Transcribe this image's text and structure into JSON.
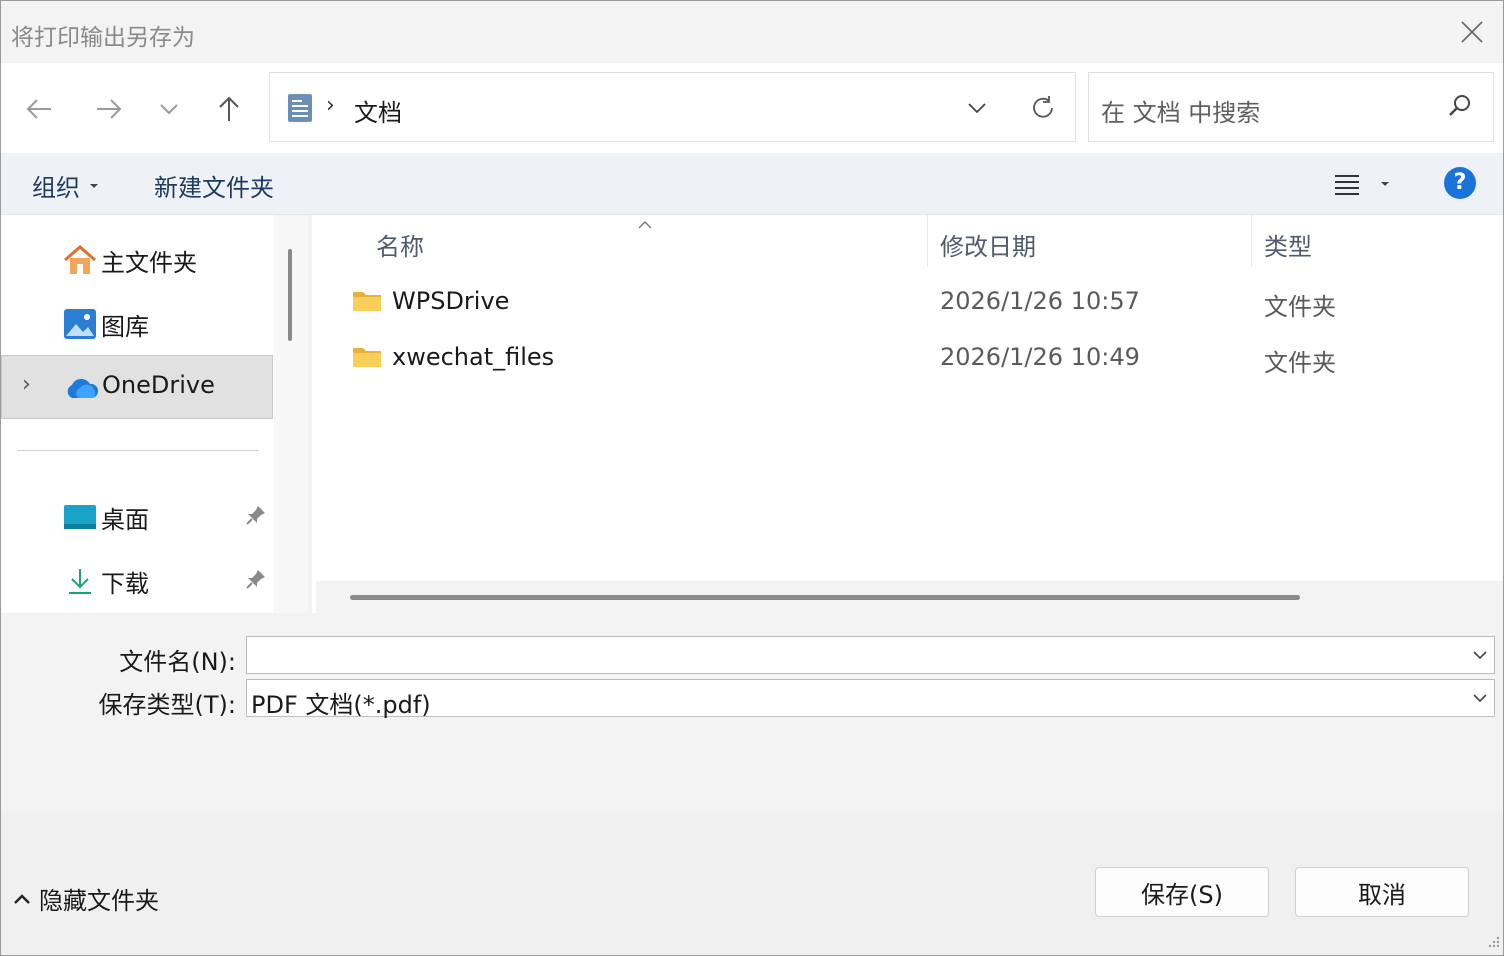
{
  "window": {
    "title": "将打印输出另存为"
  },
  "nav": {
    "back_icon": "arrow-left-icon",
    "forward_icon": "arrow-right-icon",
    "recent_icon": "chevron-down-icon",
    "up_icon": "arrow-up-icon"
  },
  "address": {
    "separator": "›",
    "location": "文档"
  },
  "search": {
    "placeholder": "在 文档 中搜索"
  },
  "commandbar": {
    "organize_label": "组织",
    "newfolder_label": "新建文件夹",
    "help_label": "?"
  },
  "navpane": {
    "items": [
      {
        "label": "主文件夹",
        "icon": "home-icon"
      },
      {
        "label": "图库",
        "icon": "gallery-icon"
      },
      {
        "label": "OneDrive",
        "icon": "onedrive-cloud-icon",
        "selected": true,
        "expander": "›"
      },
      {
        "label": "桌面",
        "icon": "desktop-icon",
        "pinned": true
      },
      {
        "label": "下载",
        "icon": "download-icon",
        "pinned": true
      }
    ]
  },
  "filelist": {
    "columns": [
      "名称",
      "修改日期",
      "类型"
    ],
    "rows": [
      {
        "name": "WPSDrive",
        "date": "2026/1/26 10:57",
        "type": "文件夹"
      },
      {
        "name": "xwechat_files",
        "date": "2026/1/26 10:49",
        "type": "文件夹"
      }
    ]
  },
  "fields": {
    "filename_label": "文件名(N):",
    "filename_value": "",
    "savetype_label": "保存类型(T):",
    "savetype_value": "PDF 文档(*.pdf)"
  },
  "footer": {
    "hide_folders_label": "隐藏文件夹",
    "save_label": "保存(S)",
    "cancel_label": "取消"
  },
  "colors": {
    "accent": "#1a73d9",
    "folder": "#f5c542",
    "command_bar_bg": "#eef2f7"
  }
}
